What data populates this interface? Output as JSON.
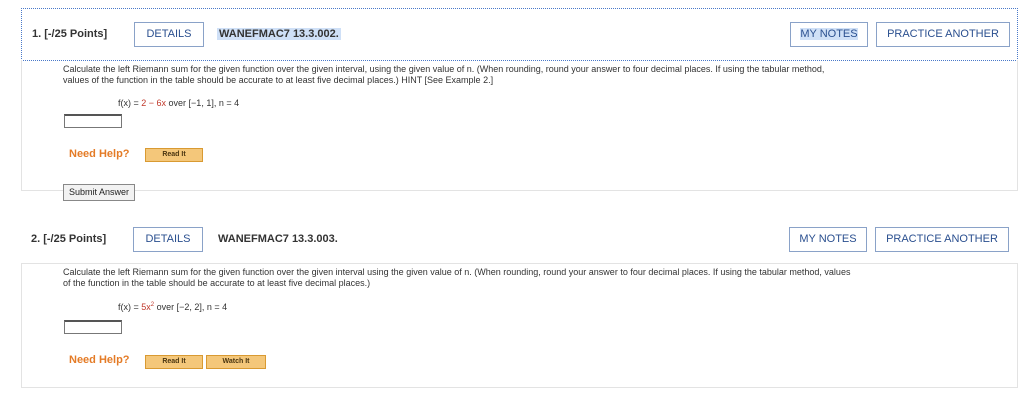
{
  "questions": [
    {
      "number": "1.  [-/25 Points]",
      "details": "DETAILS",
      "code": "WANEFMAC7 13.3.002.",
      "my_notes": "MY NOTES",
      "practice": "PRACTICE ANOTHER",
      "text_line1": "Calculate the left Riemann sum for the given function over the given interval, using the given value of n. (When rounding, round your answer to four decimal places. If using the tabular method,",
      "text_line2": "values of the function in the table should be accurate to at least five decimal places.) HINT [See Example 2.]",
      "fx_prefix": "f(x) = ",
      "fx_red": "2 − 6x",
      "fx_suffix": " over [−1, 1], n = 4",
      "need_help": "Need Help?",
      "read_it": "Read It",
      "submit": "Submit Answer"
    },
    {
      "number": "2.  [-/25 Points]",
      "details": "DETAILS",
      "code": "WANEFMAC7 13.3.003.",
      "my_notes": "MY NOTES",
      "practice": "PRACTICE ANOTHER",
      "text_line1": "Calculate the left Riemann sum for the given function over the given interval using the given value of n. (When rounding, round your answer to four decimal places. If using the tabular method, values",
      "text_line2": "of the function in the table should be accurate to at least five decimal places.)",
      "fx_prefix": "f(x) = ",
      "fx_red": "5x",
      "fx_sup": "2",
      "fx_suffix": " over [−2, 2], n = 4",
      "need_help": "Need Help?",
      "read_it": "Read It",
      "watch_it": "Watch It"
    }
  ]
}
